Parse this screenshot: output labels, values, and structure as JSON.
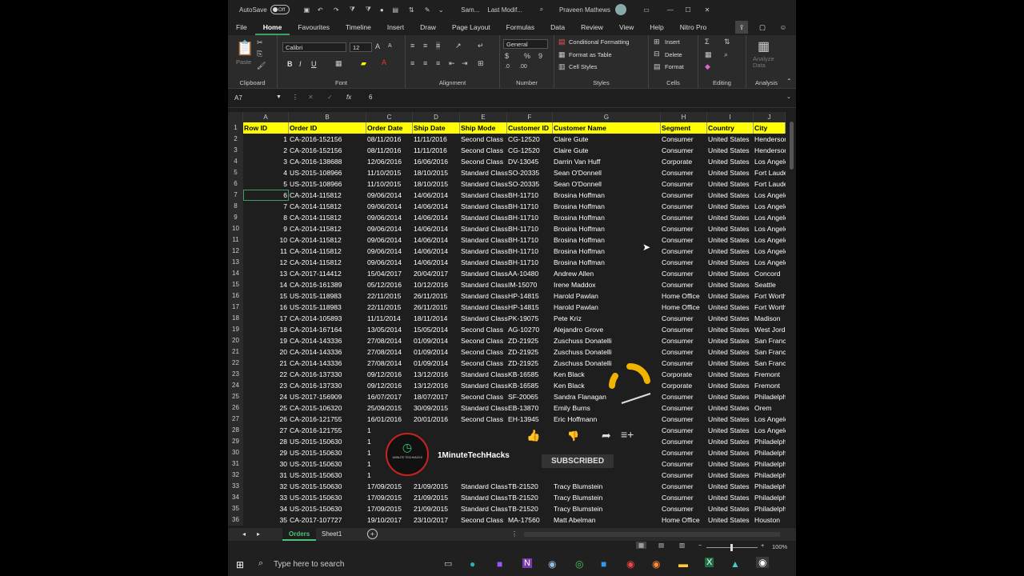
{
  "titlebar": {
    "autosave": "AutoSave",
    "autosave_state": "Off",
    "doc_title": "Sam...",
    "modified": "Last Modif...",
    "user": "Praveen Mathews"
  },
  "tabs": [
    "File",
    "Home",
    "Favourites",
    "Timeline",
    "Insert",
    "Draw",
    "Page Layout",
    "Formulas",
    "Data",
    "Review",
    "View",
    "Help",
    "Nitro Pro"
  ],
  "active_tab": "Home",
  "ribbon": {
    "clipboard": "Clipboard",
    "paste": "Paste",
    "font_group": "Font",
    "font_name": "Calibri",
    "font_size": "12",
    "bold": "B",
    "italic": "I",
    "underline": "U",
    "alignment": "Alignment",
    "number_format": "General",
    "number": "Number",
    "conditional": "Conditional Formatting",
    "format_table": "Format as Table",
    "cell_styles": "Cell Styles",
    "styles": "Styles",
    "insert": "Insert",
    "delete": "Delete",
    "format": "Format",
    "cells": "Cells",
    "editing": "Editing",
    "analyze": "Analyze Data",
    "analysis": "Analysis"
  },
  "formula_bar": {
    "name_box": "A7",
    "fx": "fx",
    "value": "6"
  },
  "columns": [
    "A",
    "B",
    "C",
    "D",
    "E",
    "F",
    "G",
    "H",
    "I",
    "J"
  ],
  "headers": [
    "Row ID",
    "Order ID",
    "Order Date",
    "Ship Date",
    "Ship Mode",
    "Customer ID",
    "Customer Name",
    "Segment",
    "Country",
    "City"
  ],
  "rows": [
    [
      "1",
      "CA-2016-152156",
      "08/11/2016",
      "11/11/2016",
      "Second Class",
      "CG-12520",
      "Claire Gute",
      "Consumer",
      "United States",
      "Henderson"
    ],
    [
      "2",
      "CA-2016-152156",
      "08/11/2016",
      "11/11/2016",
      "Second Class",
      "CG-12520",
      "Claire Gute",
      "Consumer",
      "United States",
      "Henderson"
    ],
    [
      "3",
      "CA-2016-138688",
      "12/06/2016",
      "16/06/2016",
      "Second Class",
      "DV-13045",
      "Darrin Van Huff",
      "Corporate",
      "United States",
      "Los Angeles"
    ],
    [
      "4",
      "US-2015-108966",
      "11/10/2015",
      "18/10/2015",
      "Standard Class",
      "SO-20335",
      "Sean O'Donnell",
      "Consumer",
      "United States",
      "Fort Lauderdale"
    ],
    [
      "5",
      "US-2015-108966",
      "11/10/2015",
      "18/10/2015",
      "Standard Class",
      "SO-20335",
      "Sean O'Donnell",
      "Consumer",
      "United States",
      "Fort Lauderdale"
    ],
    [
      "6",
      "CA-2014-115812",
      "09/06/2014",
      "14/06/2014",
      "Standard Class",
      "BH-11710",
      "Brosina Hoffman",
      "Consumer",
      "United States",
      "Los Angeles"
    ],
    [
      "7",
      "CA-2014-115812",
      "09/06/2014",
      "14/06/2014",
      "Standard Class",
      "BH-11710",
      "Brosina Hoffman",
      "Consumer",
      "United States",
      "Los Angeles"
    ],
    [
      "8",
      "CA-2014-115812",
      "09/06/2014",
      "14/06/2014",
      "Standard Class",
      "BH-11710",
      "Brosina Hoffman",
      "Consumer",
      "United States",
      "Los Angeles"
    ],
    [
      "9",
      "CA-2014-115812",
      "09/06/2014",
      "14/06/2014",
      "Standard Class",
      "BH-11710",
      "Brosina Hoffman",
      "Consumer",
      "United States",
      "Los Angeles"
    ],
    [
      "10",
      "CA-2014-115812",
      "09/06/2014",
      "14/06/2014",
      "Standard Class",
      "BH-11710",
      "Brosina Hoffman",
      "Consumer",
      "United States",
      "Los Angeles"
    ],
    [
      "11",
      "CA-2014-115812",
      "09/06/2014",
      "14/06/2014",
      "Standard Class",
      "BH-11710",
      "Brosina Hoffman",
      "Consumer",
      "United States",
      "Los Angeles"
    ],
    [
      "12",
      "CA-2014-115812",
      "09/06/2014",
      "14/06/2014",
      "Standard Class",
      "BH-11710",
      "Brosina Hoffman",
      "Consumer",
      "United States",
      "Los Angeles"
    ],
    [
      "13",
      "CA-2017-114412",
      "15/04/2017",
      "20/04/2017",
      "Standard Class",
      "AA-10480",
      "Andrew Allen",
      "Consumer",
      "United States",
      "Concord"
    ],
    [
      "14",
      "CA-2016-161389",
      "05/12/2016",
      "10/12/2016",
      "Standard Class",
      "IM-15070",
      "Irene Maddox",
      "Consumer",
      "United States",
      "Seattle"
    ],
    [
      "15",
      "US-2015-118983",
      "22/11/2015",
      "26/11/2015",
      "Standard Class",
      "HP-14815",
      "Harold Pawlan",
      "Home Office",
      "United States",
      "Fort Worth"
    ],
    [
      "16",
      "US-2015-118983",
      "22/11/2015",
      "26/11/2015",
      "Standard Class",
      "HP-14815",
      "Harold Pawlan",
      "Home Office",
      "United States",
      "Fort Worth"
    ],
    [
      "17",
      "CA-2014-105893",
      "11/11/2014",
      "18/11/2014",
      "Standard Class",
      "PK-19075",
      "Pete Kriz",
      "Consumer",
      "United States",
      "Madison"
    ],
    [
      "18",
      "CA-2014-167164",
      "13/05/2014",
      "15/05/2014",
      "Second Class",
      "AG-10270",
      "Alejandro Grove",
      "Consumer",
      "United States",
      "West Jordan"
    ],
    [
      "19",
      "CA-2014-143336",
      "27/08/2014",
      "01/09/2014",
      "Second Class",
      "ZD-21925",
      "Zuschuss Donatelli",
      "Consumer",
      "United States",
      "San Francisco"
    ],
    [
      "20",
      "CA-2014-143336",
      "27/08/2014",
      "01/09/2014",
      "Second Class",
      "ZD-21925",
      "Zuschuss Donatelli",
      "Consumer",
      "United States",
      "San Francisco"
    ],
    [
      "21",
      "CA-2014-143336",
      "27/08/2014",
      "01/09/2014",
      "Second Class",
      "ZD-21925",
      "Zuschuss Donatelli",
      "Consumer",
      "United States",
      "San Francisco"
    ],
    [
      "22",
      "CA-2016-137330",
      "09/12/2016",
      "13/12/2016",
      "Standard Class",
      "KB-16585",
      "Ken Black",
      "Corporate",
      "United States",
      "Fremont"
    ],
    [
      "23",
      "CA-2016-137330",
      "09/12/2016",
      "13/12/2016",
      "Standard Class",
      "KB-16585",
      "Ken Black",
      "Corporate",
      "United States",
      "Fremont"
    ],
    [
      "24",
      "US-2017-156909",
      "16/07/2017",
      "18/07/2017",
      "Second Class",
      "SF-20065",
      "Sandra Flanagan",
      "Consumer",
      "United States",
      "Philadelphia"
    ],
    [
      "25",
      "CA-2015-106320",
      "25/09/2015",
      "30/09/2015",
      "Standard Class",
      "EB-13870",
      "Emily Burns",
      "Consumer",
      "United States",
      "Orem"
    ],
    [
      "26",
      "CA-2016-121755",
      "16/01/2016",
      "20/01/2016",
      "Second Class",
      "EH-13945",
      "Eric Hoffmann",
      "Consumer",
      "United States",
      "Los Angeles"
    ],
    [
      "27",
      "CA-2016-121755",
      "1",
      "",
      "",
      "",
      "",
      "Consumer",
      "United States",
      "Los Angeles"
    ],
    [
      "28",
      "US-2015-150630",
      "1",
      "",
      "",
      "",
      "",
      "Consumer",
      "United States",
      "Philadelphia"
    ],
    [
      "29",
      "US-2015-150630",
      "1",
      "",
      "",
      "",
      "",
      "Consumer",
      "United States",
      "Philadelphia"
    ],
    [
      "30",
      "US-2015-150630",
      "1",
      "",
      "",
      "",
      "",
      "Consumer",
      "United States",
      "Philadelphia"
    ],
    [
      "31",
      "US-2015-150630",
      "1",
      "",
      "",
      "",
      "",
      "Consumer",
      "United States",
      "Philadelphia"
    ],
    [
      "32",
      "US-2015-150630",
      "17/09/2015",
      "21/09/2015",
      "Standard Class",
      "TB-21520",
      "Tracy Blumstein",
      "Consumer",
      "United States",
      "Philadelphia"
    ],
    [
      "33",
      "US-2015-150630",
      "17/09/2015",
      "21/09/2015",
      "Standard Class",
      "TB-21520",
      "Tracy Blumstein",
      "Consumer",
      "United States",
      "Philadelphia"
    ],
    [
      "34",
      "US-2015-150630",
      "17/09/2015",
      "21/09/2015",
      "Standard Class",
      "TB-21520",
      "Tracy Blumstein",
      "Consumer",
      "United States",
      "Philadelphia"
    ],
    [
      "35",
      "CA-2017-107727",
      "19/10/2017",
      "23/10/2017",
      "Second Class",
      "MA-17560",
      "Matt Abelman",
      "Home Office",
      "United States",
      "Houston"
    ]
  ],
  "row_numbers": [
    "1",
    "2",
    "3",
    "4",
    "5",
    "6",
    "7",
    "8",
    "9",
    "10",
    "11",
    "12",
    "13",
    "14",
    "15",
    "16",
    "17",
    "18",
    "19",
    "20",
    "21",
    "22",
    "23",
    "24",
    "25",
    "26",
    "27",
    "28",
    "29",
    "30",
    "31",
    "32",
    "33",
    "34",
    "35",
    "36"
  ],
  "sheets": [
    "Orders",
    "Sheet1"
  ],
  "active_sheet": "Orders",
  "status": {
    "zoom": "100%"
  },
  "taskbar": {
    "search_placeholder": "Type here to search"
  },
  "overlay": {
    "channel": "1MinuteTechHacks",
    "subscribed": "SUBSCRIBED",
    "logo_text": "1MINUTE TECHHACKS"
  },
  "colors": {
    "header_fill": "#ffff00",
    "accent": "#3fa065",
    "subscribed_bg": "#333333",
    "like": "#3ea6ff"
  }
}
